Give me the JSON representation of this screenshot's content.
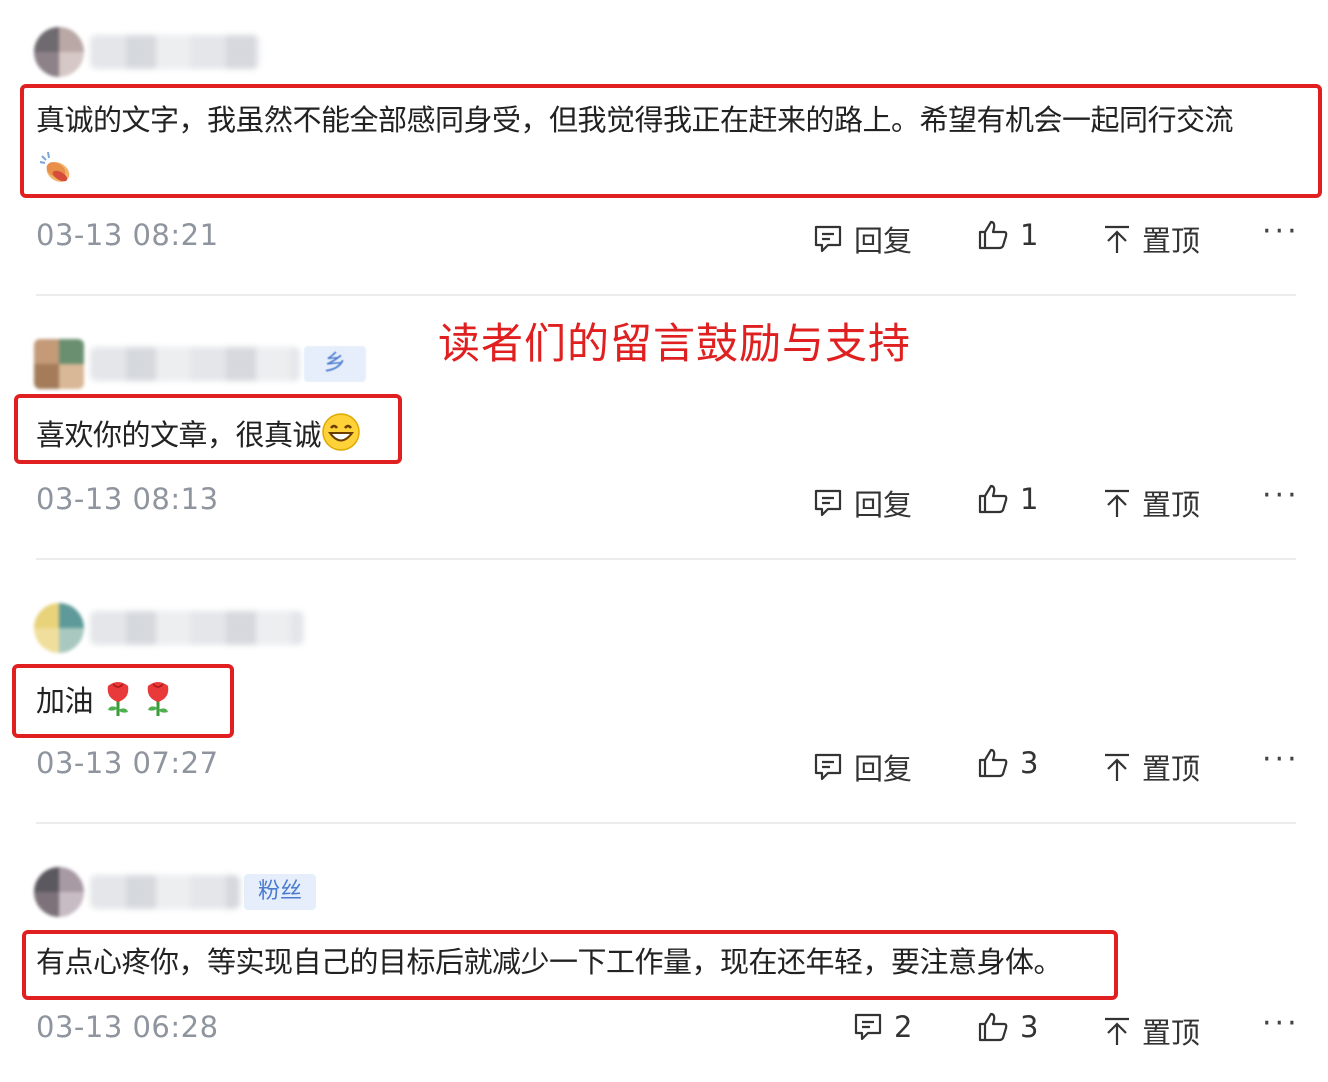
{
  "annotation": "读者们的留言鼓励与支持",
  "actions": {
    "reply_label": "回复",
    "pin_label": "置顶",
    "more_label": "···"
  },
  "comments": [
    {
      "text": "真诚的文字，我虽然不能全部感同身受，但我觉得我正在赶来的路上。希望有机会一起同行交流",
      "emoji": "clapping-hands",
      "timestamp": "03-13 08:21",
      "likes": "1",
      "badge": ""
    },
    {
      "text": "喜欢你的文章，很真诚",
      "emoji": "grinning-face",
      "timestamp": "03-13 08:13",
      "likes": "1",
      "badge": "乡"
    },
    {
      "text": "加油",
      "emoji": "rose x2",
      "timestamp": "03-13 07:27",
      "likes": "3",
      "badge": ""
    },
    {
      "text": "有点心疼你，等实现自己的目标后就减少一下工作量，现在还年轻，要注意身体。",
      "emoji": "",
      "timestamp": "03-13 06:28",
      "likes": "3",
      "reply_count": "2",
      "badge": "粉丝"
    }
  ]
}
